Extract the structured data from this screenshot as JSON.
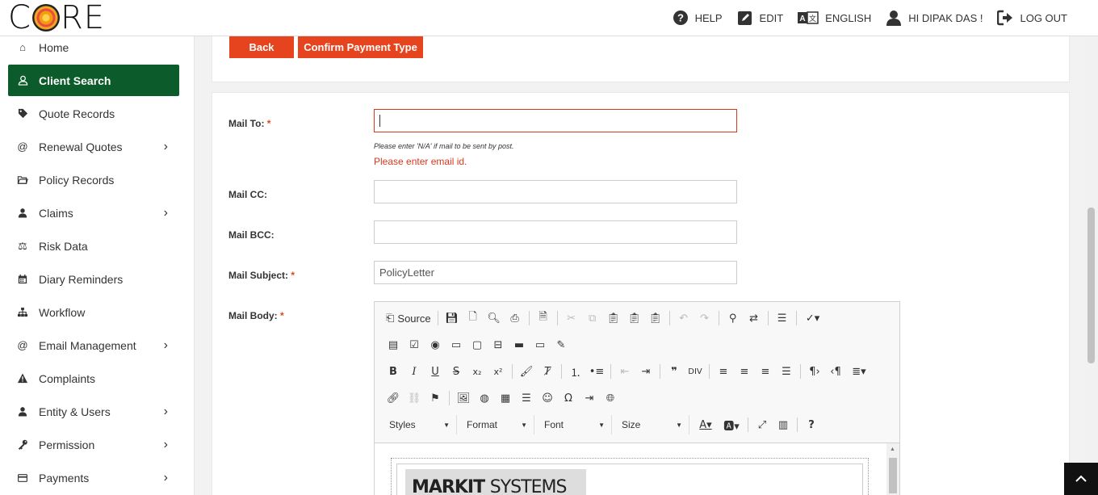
{
  "header": {
    "logo_text_c": "C",
    "logo_text_re": "RE",
    "help": "HELP",
    "edit": "EDIT",
    "language": "ENGLISH",
    "user": "HI DIPAK DAS !",
    "logout": "LOG OUT"
  },
  "sidebar": {
    "items": [
      {
        "label": "Home",
        "icon": "home-icon"
      },
      {
        "label": "Client Search",
        "icon": "user-icon",
        "active": true
      },
      {
        "label": "Quote Records",
        "icon": "tag-icon"
      },
      {
        "label": "Renewal Quotes",
        "icon": "at-icon",
        "submenu": true
      },
      {
        "label": "Policy Records",
        "icon": "folder-icon"
      },
      {
        "label": "Claims",
        "icon": "person-icon",
        "submenu": true
      },
      {
        "label": "Risk Data",
        "icon": "balance-icon"
      },
      {
        "label": "Diary Reminders",
        "icon": "calendar-icon"
      },
      {
        "label": "Workflow",
        "icon": "sitemap-icon"
      },
      {
        "label": "Email Management",
        "icon": "at-icon",
        "submenu": true
      },
      {
        "label": "Complaints",
        "icon": "warning-icon"
      },
      {
        "label": "Entity & Users",
        "icon": "person-icon",
        "submenu": true
      },
      {
        "label": "Permission",
        "icon": "key-icon",
        "submenu": true
      },
      {
        "label": "Payments",
        "icon": "credit-card-icon",
        "submenu": true
      }
    ]
  },
  "actions": {
    "back": "Back",
    "confirm": "Confirm Payment Type"
  },
  "form": {
    "mail_to_label": "Mail To:",
    "mail_to_value": "",
    "mail_to_hint": "Please enter 'N/A' if mail to be sent by post.",
    "mail_to_error": "Please enter email id.",
    "mail_cc_label": "Mail CC:",
    "mail_cc_value": "",
    "mail_bcc_label": "Mail BCC:",
    "mail_bcc_value": "",
    "mail_subject_label": "Mail Subject:",
    "mail_subject_value": "PolicyLetter",
    "mail_body_label": "Mail Body:",
    "required_mark": "*"
  },
  "editor": {
    "source": "Source",
    "styles": "Styles",
    "format": "Format",
    "font": "Font",
    "size": "Size",
    "logo_markit": "MARKIT",
    "logo_systems": "SYSTEMS"
  }
}
